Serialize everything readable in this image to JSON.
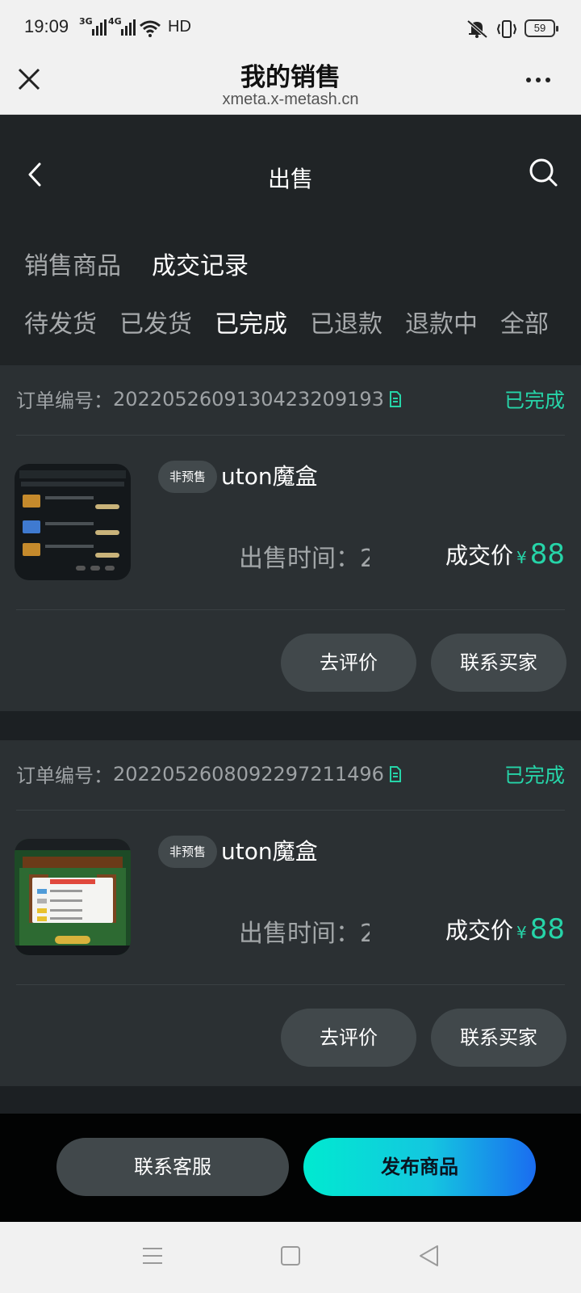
{
  "status_bar": {
    "time": "19:09",
    "signal1": "3G",
    "signal2": "4G",
    "hd": "HD",
    "battery": "59"
  },
  "browser": {
    "title": "我的销售",
    "url": "xmeta.x-metash.cn"
  },
  "app_header": {
    "title": "出售"
  },
  "main_tabs": [
    {
      "label": "销售商品",
      "active": false
    },
    {
      "label": "成交记录",
      "active": true
    }
  ],
  "sub_tabs": [
    {
      "label": "待发货",
      "active": false
    },
    {
      "label": "已发货",
      "active": false
    },
    {
      "label": "已完成",
      "active": true
    },
    {
      "label": "已退款",
      "active": false
    },
    {
      "label": "退款中",
      "active": false
    },
    {
      "label": "全部",
      "active": false
    }
  ],
  "orders": [
    {
      "order_label": "订单编号：",
      "order_no": "2022052609130423209193",
      "status": "已完成",
      "tag": "非预售",
      "name": "uton魔盒",
      "sale_time_label": "出售时间：2",
      "deal_label": "成交价",
      "currency": "¥",
      "price": "88",
      "review_btn": "去评价",
      "contact_btn": "联系买家"
    },
    {
      "order_label": "订单编号：",
      "order_no": "2022052608092297211496",
      "status": "已完成",
      "tag": "非预售",
      "name": "uton魔盒",
      "sale_time_label": "出售时间：2",
      "deal_label": "成交价",
      "currency": "¥",
      "price": "88",
      "review_btn": "去评价",
      "contact_btn": "联系买家"
    }
  ],
  "footer": {
    "customer_service": "联系客服",
    "publish": "发布商品"
  },
  "colors": {
    "accent": "#26d4a8",
    "background": "#1c2023",
    "card": "#2b3033",
    "button": "#41484b"
  }
}
